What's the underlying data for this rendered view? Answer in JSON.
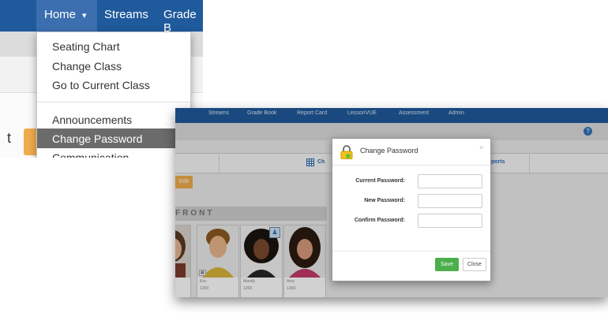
{
  "left_menu": {
    "nav": {
      "home": "Home",
      "caret": "▾",
      "streams": "Streams",
      "gradebook": "Grade B"
    },
    "bg_text": "t",
    "items": [
      "Seating Chart",
      "Change Class",
      "Go to Current Class",
      "Announcements",
      "Change Password",
      "Communication"
    ],
    "active_item": "Change Password"
  },
  "right_panel": {
    "nav_items": [
      "Streams",
      "Grade Book",
      "Report Card",
      "LessonVUE",
      "Assessment",
      "Admin"
    ],
    "help": "?",
    "tabs": [
      "Ch",
      "ports"
    ],
    "edit_label": "Edit",
    "front_label": "FRONT",
    "students": [
      {
        "name": "",
        "number": ""
      },
      {
        "name": "Eric",
        "number": "1269"
      },
      {
        "name": "Mandy",
        "number": "1269"
      },
      {
        "name": "Amy",
        "number": "1269"
      }
    ]
  },
  "modal": {
    "title": "Change Password",
    "close_x": "×",
    "current_password_label": "Current Password:",
    "new_password_label": "New Password:",
    "confirm_password_label": "Confirm Password:",
    "save_label": "Save",
    "close_label": "Close"
  }
}
